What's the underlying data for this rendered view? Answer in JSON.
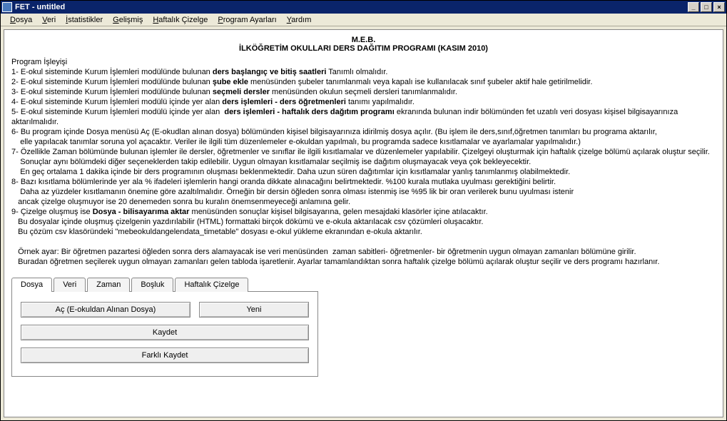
{
  "window": {
    "title": "FET - untitled"
  },
  "menubar": {
    "items": [
      {
        "label": "Dosya",
        "u": 0
      },
      {
        "label": "Veri",
        "u": 0
      },
      {
        "label": "İstatistikler",
        "u": 0
      },
      {
        "label": "Gelişmiş",
        "u": 0
      },
      {
        "label": "Haftalık Çizelge",
        "u": 0
      },
      {
        "label": "Program Ayarları",
        "u": 0
      },
      {
        "label": "Yardım",
        "u": 0
      }
    ]
  },
  "heading1": "M.E.B.",
  "heading2": "İLKÖĞRETİM OKULLARI DERS DAĞITIM PROGRAMI (KASIM 2010)",
  "intro_label": "Program İşleyişi",
  "line1a": "1- E-okul sisteminde Kurum İşlemleri modülünde bulunan ",
  "line1b": "ders başlangıç ve bitiş saatleri",
  "line1c": " Tanımlı olmalıdır.",
  "line2a": "2- E-okul sisteminde Kurum İşlemleri modülünde bulunan ",
  "line2b": "şube ekle",
  "line2c": " menüsünden şubeler tanımlanmalı veya kapalı ise kullanılacak sınıf şubeler aktif hale getirilmelidir.",
  "line3a": "3- E-okul sisteminde Kurum İşlemleri modülünde bulunan ",
  "line3b": "seçmeli dersler",
  "line3c": " menüsünden okulun seçmeli dersleri tanımlanmalıdır.",
  "line4a": "4- E-okul sisteminde Kurum İşlemleri modülü içinde yer alan ",
  "line4b": "ders işlemleri - ders öğretmenleri",
  "line4c": " tanımı yapılmalıdır.",
  "line5a": "5- E-okul sisteminde Kurum İşlemleri modülü içinde yer alan  ",
  "line5b": "ders işlemleri - haftalık ders dağıtım programı",
  "line5c": " ekranında bulunan indir bölümünden fet uzatılı veri dosyası kişisel bilgisayarınıza aktarılmalıdır.",
  "line6": "6- Bu program içinde Dosya menüsü Aç (E-okudlan alınan dosya) bölümünden kişisel bilgisayarınıza idirilmiş dosya açılır. (Bu işlem ile ders,sınıf,öğretmen tanımları bu programa aktarılır,\n    elle yapılacak tanımlar soruna yol açacaktır. Veriler ile ilgili tüm düzenlemeler e-okuldan yapılmalı, bu programda sadece kısıtlamalar ve ayarlamalar yapılmalıdır.)",
  "line7": "7- Özellikle Zaman bölümünde bulunan işlemler ile dersler, öğretmenler ve sınıflar ile ilgili kısıtlamalar ve düzenlemeler yapılabilir. Çizelgeyi oluşturmak için haftalık çizelge bölümü açılarak oluştur seçilir.\n    Sonuçlar aynı bölümdeki diğer seçeneklerden takip edilebilir. Uygun olmayan kısıtlamalar seçilmiş ise dağıtım oluşmayacak veya çok bekleyecektir.\n    En geç ortalama 1 dakika içinde bir ders programının oluşması beklenmektedir. Daha uzun süren dağıtımlar için kısıtlamalar yanlış tanımlanmış olabilmektedir.",
  "line8": "8- Bazı kısıtlama bölümlerinde yer ala % ifadeleri işlemlerin hangi oranda dikkate alınacağını belirtmektedir. %100 kurala mutlaka uyulması gerektiğini belirtir.\n    Daha az yüzdeler kısıtlamanın önemine göre azaltılmalıdır. Örneğin bir dersin öğleden sonra olması istenmiş ise %95 lik bir oran verilerek bunu uyulması istenir\n   ancak çizelge oluşmuyor ise 20 denemeden sonra bu kuralın önemsenmeyeceği anlamına gelir.",
  "line9a": "9- Çizelge oluşmuş ise ",
  "line9b": "Dosya - bilisayarıma aktar",
  "line9c": " menüsünden sonuçlar kişisel bilgisayarına, gelen mesajdaki klasörler içine atılacaktır.\n   Bu dosyalar içinde oluşmuş çizelgenin yazdırılabilir (HTML) formattaki birçok dökümü ve e-okula aktarılacak csv çözümleri oluşacaktır.\n   Bu çözüm csv klasöründeki \"mebeokuldangelendata_timetable\" dosyası e-okul yükleme ekranından e-okula aktarılır.",
  "example": "   Örnek ayar: Bir öğretmen pazartesi öğleden sonra ders alamayacak ise veri menüsünden  zaman sabitleri- öğretmenler- bir öğretmenin uygun olmayan zamanları bölümüne girilir.\n   Buradan öğretmen seçilerek uygun olmayan zamanları gelen tabloda işaretlenir. Ayarlar tamamlandıktan sonra haftalık çizelge bölümü açılarak oluştur seçilir ve ders programı hazırlanır.",
  "tabs": {
    "items": [
      "Dosya",
      "Veri",
      "Zaman",
      "Boşluk",
      "Haftalık Çizelge"
    ],
    "active": 0
  },
  "buttons": {
    "open": "Aç (E-okuldan Alınan Dosya)",
    "new": "Yeni",
    "save": "Kaydet",
    "save_as": "Farklı Kaydet"
  }
}
